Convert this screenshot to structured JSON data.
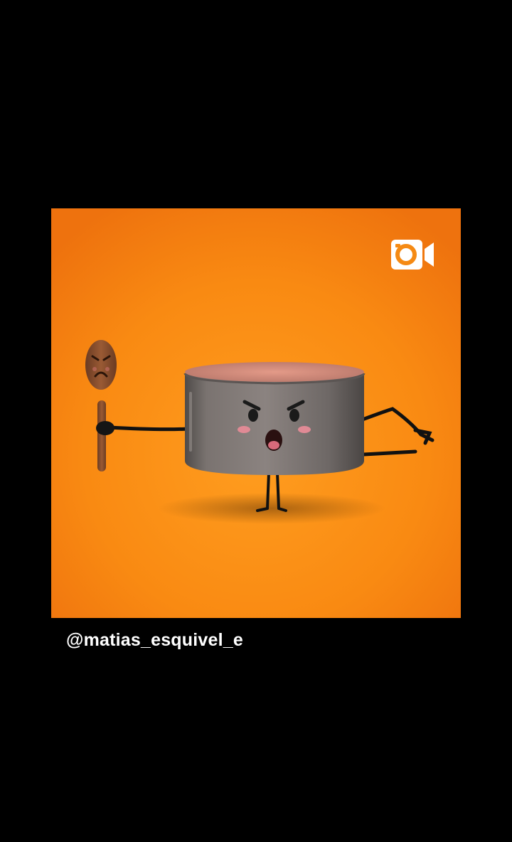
{
  "post": {
    "username": "@matias_esquivel_e",
    "media_type_icon": "video-camera-icon",
    "illustration": "pot-character-with-spoon-character"
  },
  "colors": {
    "screen_background": "#000000",
    "media_background": "#f98a10",
    "badge": "#ffffff",
    "caption_text": "#ffffff"
  }
}
